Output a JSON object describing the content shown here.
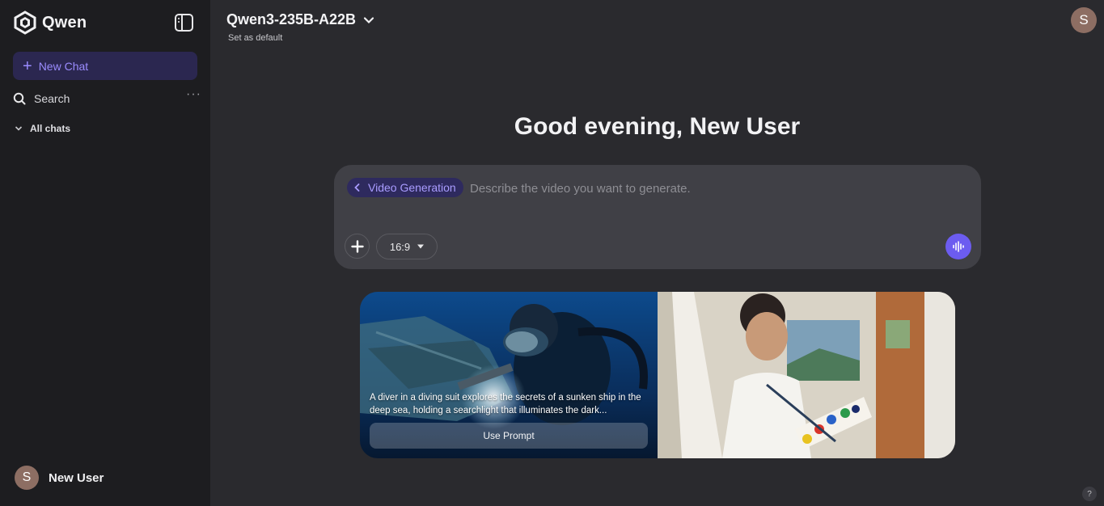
{
  "sidebar": {
    "brand": "Qwen",
    "new_chat_label": "New Chat",
    "search_label": "Search",
    "more_label": "···",
    "all_chats_label": "All chats",
    "user": {
      "initial": "S",
      "name": "New User"
    }
  },
  "header": {
    "model_name": "Qwen3-235B-A22B",
    "set_default": "Set as default",
    "avatar_initial": "S"
  },
  "main": {
    "greeting": "Good evening, New User",
    "composer": {
      "mode_chip": "Video Generation",
      "placeholder": "Describe the video you want to generate.",
      "aspect_ratio": "16:9"
    },
    "cards": [
      {
        "text": "A diver in a diving suit explores the secrets of a sunken ship in the deep sea, holding a searchlight that illuminates the dark...",
        "button": "Use Prompt"
      },
      {
        "text": "",
        "button": ""
      }
    ]
  },
  "help_label": "?",
  "colors": {
    "accent": "#6c5cf0",
    "chip_text": "#a99cff",
    "sidebar_bg": "#1d1d20",
    "main_bg": "#2a2a2e"
  }
}
